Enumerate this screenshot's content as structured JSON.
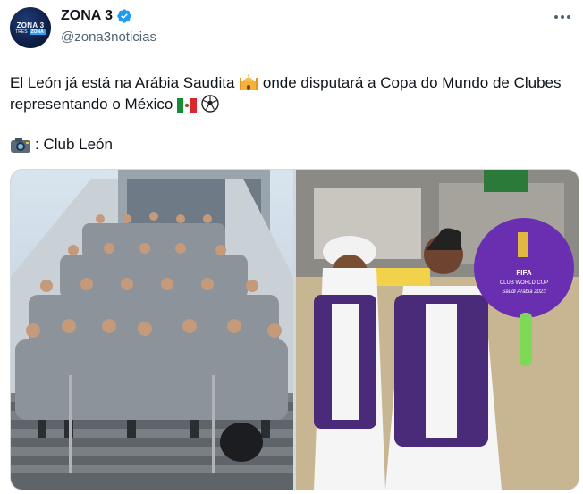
{
  "account": {
    "display_name": "ZONA 3",
    "handle": "@zona3noticias",
    "verified": true,
    "avatar_logo_line1": "ZONA 3",
    "avatar_logo_line2a": "TRES",
    "avatar_logo_line2b": "ZONA"
  },
  "post": {
    "text_part1": "El León já está na Arábia Saudita",
    "text_part2": "onde disputará a Copa do Mundo de Clubes representando o México",
    "credit": ": Club León"
  },
  "media": {
    "photo_2_sign": {
      "line1": "FIFA",
      "line2": "CLUB WORLD CUP",
      "line3": "Saudi Arabia 2023"
    }
  },
  "icons": {
    "more": "more-horizontal-icon",
    "verified": "verified-badge-icon",
    "mosque": "mosque-emoji",
    "flag": "mexico-flag-emoji",
    "ball": "soccer-ball-emoji",
    "camera": "camera-emoji"
  },
  "colors": {
    "verified_blue": "#1d9bf0",
    "handle_gray": "#536471",
    "sign_purple": "#6a2fb0"
  }
}
